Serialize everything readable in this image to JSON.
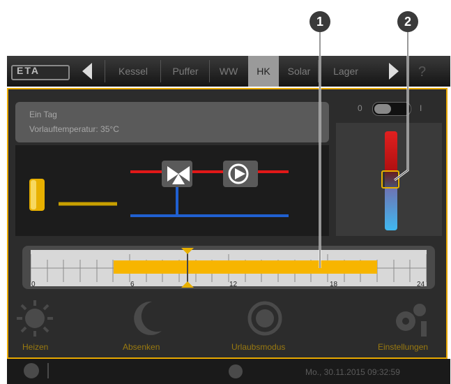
{
  "tabs": [
    {
      "label": "Kessel",
      "active": false
    },
    {
      "label": "Puffer",
      "active": false
    },
    {
      "label": "WW",
      "active": false
    },
    {
      "label": "HK",
      "active": true
    },
    {
      "label": "Solar",
      "active": false
    },
    {
      "label": "Lager",
      "active": false
    }
  ],
  "logo_text": "ETA",
  "help_label": "?",
  "info": {
    "line1": "Ein Tag",
    "line2": "Vorlauftemperatur: 35°C"
  },
  "switch": {
    "off_label": "0",
    "on_label": "I"
  },
  "timeline": {
    "hours": [
      "0",
      "6",
      "12",
      "18",
      "24"
    ],
    "active_start_hour": 5,
    "active_end_hour": 21,
    "marker_hour": 9.5
  },
  "buttons": {
    "heizen": "Heizen",
    "absenken": "Absenken",
    "zeitaktiv": "Urlaubsmodus",
    "einstellungen": "Einstellungen"
  },
  "status": {
    "datetime": "Mo., 30.11.2015 09:32:59"
  },
  "callouts": {
    "one": "1",
    "two": "2"
  },
  "colors": {
    "accent": "#e8a800",
    "hot": "#e01818",
    "cold": "#2060d0",
    "bar": "#f7b500"
  }
}
